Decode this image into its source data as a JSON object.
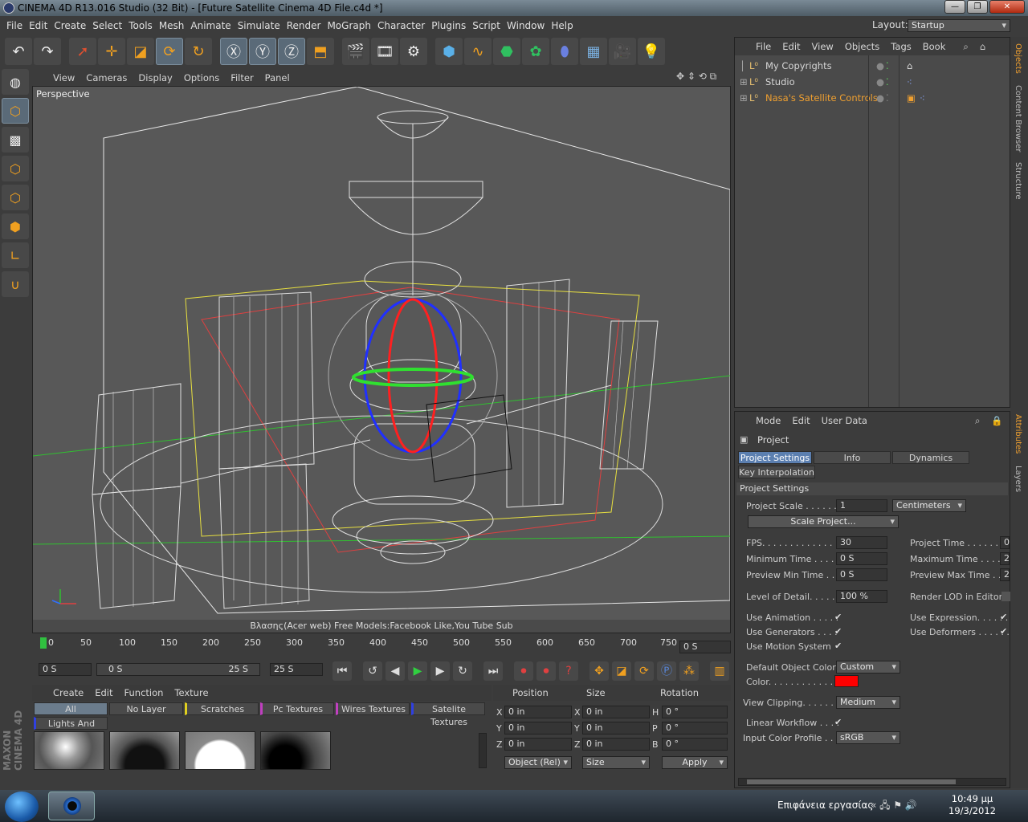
{
  "window": {
    "title": "CINEMA 4D R13.016 Studio (32 Bit) - [Future Satellite Cinema 4D File.c4d *]",
    "min": "—",
    "max": "❐",
    "close": "✕"
  },
  "menu": [
    "File",
    "Edit",
    "Create",
    "Select",
    "Tools",
    "Mesh",
    "Animate",
    "Simulate",
    "Render",
    "MoGraph",
    "Character",
    "Plugins",
    "Script",
    "Window",
    "Help"
  ],
  "layout": {
    "label": "Layout:",
    "value": "Startup"
  },
  "viewport": {
    "menu": [
      "View",
      "Cameras",
      "Display",
      "Options",
      "Filter",
      "Panel"
    ],
    "label": "Perspective",
    "footer": "Βλασης(Acer web) Free Models:Facebook Like,You Tube Sub"
  },
  "timeline": {
    "ticks": [
      "0",
      "50",
      "100",
      "150",
      "200",
      "250",
      "300",
      "350",
      "400",
      "450",
      "500",
      "550",
      "600",
      "650",
      "700",
      "750"
    ],
    "current": "0 S",
    "start": "0 S",
    "range_start": "0 S",
    "range_end": "25 S",
    "end": "25 S"
  },
  "materials": {
    "menu": [
      "Create",
      "Edit",
      "Function",
      "Texture"
    ],
    "tabs": [
      "All",
      "No Layer",
      "Scratches",
      "Pc Textures",
      "Wires Textures",
      "Satelite Textures"
    ],
    "tab2": "Lights And Floor"
  },
  "coords": {
    "headers": [
      "Position",
      "Size",
      "Rotation"
    ],
    "rows": [
      [
        "X",
        "0 in",
        "X",
        "0 in",
        "H",
        "0 °"
      ],
      [
        "Y",
        "0 in",
        "Y",
        "0 in",
        "P",
        "0 °"
      ],
      [
        "Z",
        "0 in",
        "Z",
        "0 in",
        "B",
        "0 °"
      ]
    ],
    "mode": "Object (Rel)",
    "size_mode": "Size",
    "apply": "Apply"
  },
  "objects": {
    "menu": [
      "File",
      "Edit",
      "View",
      "Objects",
      "Tags",
      "Book"
    ],
    "items": [
      {
        "name": "My Copyrights",
        "color": "#c8c8c8"
      },
      {
        "name": "Studio",
        "color": "#c8c8c8"
      },
      {
        "name": "Nasa's Satellite Controls",
        "color": "#f0a030"
      }
    ]
  },
  "attributes": {
    "menu": [
      "Mode",
      "Edit",
      "User Data"
    ],
    "title": "Project",
    "tabs": [
      "Project Settings",
      "Info",
      "Dynamics"
    ],
    "tab2": "Key Interpolation",
    "section": "Project Settings",
    "project_scale_label": "Project Scale . . . . . . .",
    "project_scale": "1",
    "scale_unit": "Centimeters",
    "scale_btn": "Scale Project...",
    "fps_label": "FPS. . . . . . . . . . . . . . .",
    "fps": "30",
    "project_time_label": "Project Time . . . . . . .",
    "project_time": "0",
    "min_time_label": "Minimum Time . . . . .",
    "min_time": "0 S",
    "max_time_label": "Maximum Time . . . . .",
    "max_time": "2",
    "prev_min_label": "Preview Min Time . . . .",
    "prev_min": "0 S",
    "prev_max_label": "Preview Max Time . . .",
    "prev_max": "2",
    "lod_label": "Level of Detail. . . . . . .",
    "lod": "100 %",
    "render_lod_label": "Render LOD in Editor",
    "use_anim": "Use Animation . . . . .",
    "use_expr": "Use Expression. . . . . .",
    "use_gen": "Use Generators . . . .",
    "use_def": "Use Deformers . . . . . .",
    "use_motion": "Use Motion System",
    "def_color_label": "Default Object Color",
    "def_color": "Custom",
    "color_label": "Color. . . . . . . . . . . .",
    "color_value": "#ff0000",
    "clipping_label": "View Clipping. . . . . .",
    "clipping": "Medium",
    "linear_label": "Linear Workflow . . . .",
    "profile_label": "Input Color Profile . .",
    "profile": "sRGB"
  },
  "sidetabs": [
    "Objects",
    "Content Browser",
    "Structure",
    "Attributes",
    "Layers"
  ],
  "taskbar": {
    "desktop": "Επιφάνεια εργασίας",
    "time": "10:49 μμ",
    "date": "19/3/2012"
  },
  "brand": "MAXON CINEMA 4D"
}
